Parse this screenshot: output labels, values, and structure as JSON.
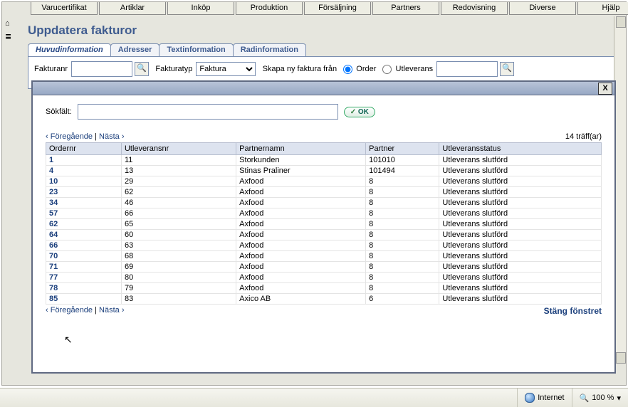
{
  "menu": [
    "Varucertifikat",
    "Artiklar",
    "Inköp",
    "Produktion",
    "Försäljning",
    "Partners",
    "Redovisning",
    "Diverse",
    "Hjälp"
  ],
  "page_title": "Uppdatera fakturor",
  "tabs": [
    "Huvudinformation",
    "Adresser",
    "Textinformation",
    "Radinformation"
  ],
  "panel": {
    "fakturanr_label": "Fakturanr",
    "fakturanr_value": "",
    "fakturatyp_label": "Fakturatyp",
    "fakturatyp_value": "Faktura",
    "skapa_label": "Skapa ny faktura från",
    "opt_order": "Order",
    "opt_utlev": "Utleverans",
    "utlev_value": ""
  },
  "overlay": {
    "close_x": "X",
    "sokfalt_label": "Sökfält:",
    "sokfalt_value": "",
    "ok_label": "OK",
    "prev": "‹ Föregående",
    "sep": " | ",
    "next": "Nästa ›",
    "hits": "14 träff(ar)",
    "headers": [
      "Ordernr",
      "Utleveransnr",
      "Partnernamn",
      "Partner",
      "Utleveransstatus"
    ],
    "rows": [
      {
        "o": "1",
        "u": "11",
        "p": "Storkunden",
        "pa": "101010",
        "s": "Utleverans slutförd"
      },
      {
        "o": "4",
        "u": "13",
        "p": "Stinas Praliner",
        "pa": "101494",
        "s": "Utleverans slutförd"
      },
      {
        "o": "10",
        "u": "29",
        "p": "Axfood",
        "pa": "8",
        "s": "Utleverans slutförd"
      },
      {
        "o": "23",
        "u": "62",
        "p": "Axfood",
        "pa": "8",
        "s": "Utleverans slutförd"
      },
      {
        "o": "34",
        "u": "46",
        "p": "Axfood",
        "pa": "8",
        "s": "Utleverans slutförd"
      },
      {
        "o": "57",
        "u": "66",
        "p": "Axfood",
        "pa": "8",
        "s": "Utleverans slutförd"
      },
      {
        "o": "62",
        "u": "65",
        "p": "Axfood",
        "pa": "8",
        "s": "Utleverans slutförd"
      },
      {
        "o": "64",
        "u": "60",
        "p": "Axfood",
        "pa": "8",
        "s": "Utleverans slutförd"
      },
      {
        "o": "66",
        "u": "63",
        "p": "Axfood",
        "pa": "8",
        "s": "Utleverans slutförd"
      },
      {
        "o": "70",
        "u": "68",
        "p": "Axfood",
        "pa": "8",
        "s": "Utleverans slutförd"
      },
      {
        "o": "71",
        "u": "69",
        "p": "Axfood",
        "pa": "8",
        "s": "Utleverans slutförd"
      },
      {
        "o": "77",
        "u": "80",
        "p": "Axfood",
        "pa": "8",
        "s": "Utleverans slutförd"
      },
      {
        "o": "78",
        "u": "79",
        "p": "Axfood",
        "pa": "8",
        "s": "Utleverans slutförd"
      },
      {
        "o": "85",
        "u": "83",
        "p": "Axico AB",
        "pa": "6",
        "s": "Utleverans slutförd"
      }
    ],
    "close_link": "Stäng fönstret"
  },
  "status": {
    "zone": "Internet",
    "zoom": "100 %"
  }
}
